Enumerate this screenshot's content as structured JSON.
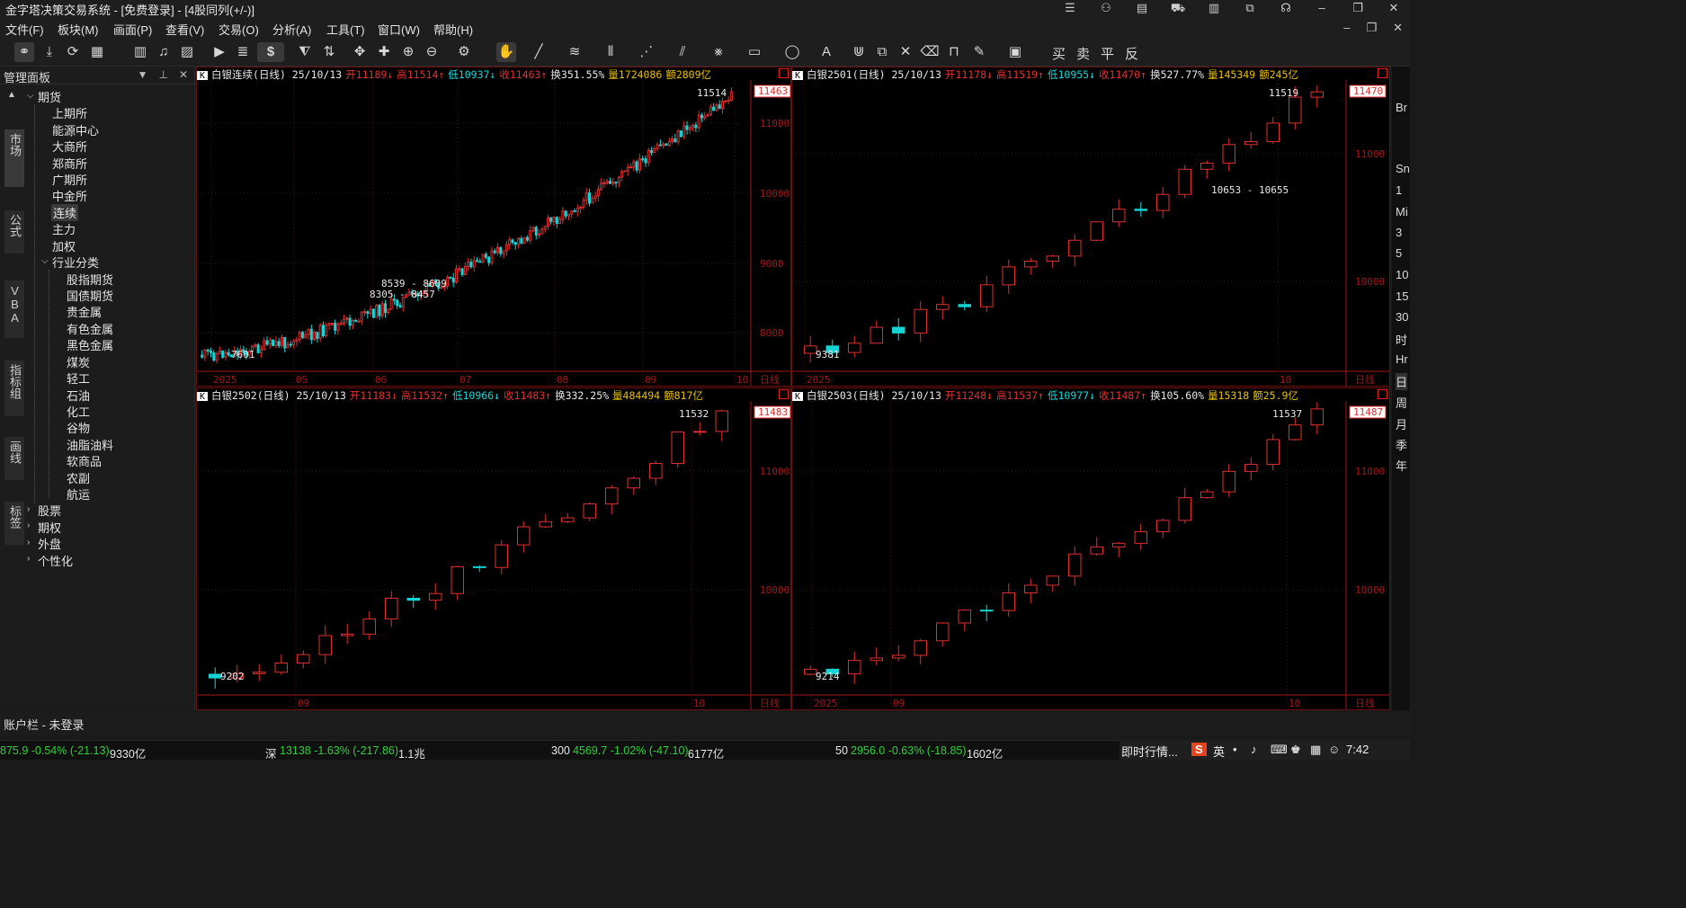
{
  "window": {
    "title": "金字塔决策交易系统 - [免费登录] - [4股同列(+/-)]"
  },
  "menu": [
    "文件(F)",
    "板块(M)",
    "画面(P)",
    "查看(V)",
    "交易(O)",
    "分析(A)",
    "工具(T)",
    "窗口(W)",
    "帮助(H)"
  ],
  "toolbar": {
    "currency_symbol": "$",
    "trade_buy": "买",
    "trade_sell": "卖",
    "trade_flat": "平",
    "trade_reverse": "反"
  },
  "side_panel": {
    "title": "管理面板",
    "vtabs": [
      "市场",
      "公式",
      "VBA",
      "指标组",
      "画线",
      "标签"
    ],
    "tree": {
      "futures": "期货",
      "exchanges": [
        "上期所",
        "能源中心",
        "大商所",
        "郑商所",
        "广期所",
        "中金所"
      ],
      "selected": "连续",
      "extra": [
        "主力",
        "加权"
      ],
      "industry": "行业分类",
      "industries": [
        "股指期货",
        "国债期货",
        "贵金属",
        "有色金属",
        "黑色金属",
        "煤炭",
        "轻工",
        "石油",
        "化工",
        "谷物",
        "油脂油料",
        "软商品",
        "农副",
        "航运"
      ],
      "roots": [
        "股票",
        "期权",
        "外盘",
        "个性化"
      ]
    }
  },
  "panels": [
    {
      "name": "白银连续(日线)",
      "date": "25/10/13",
      "open": "开11189",
      "high": "高11514",
      "low": "低10937",
      "close": "收11463",
      "change": "换351.55%",
      "volume": "量1724086",
      "amount": "额2809亿",
      "last_price": "11463",
      "y_ticks": [
        "11000",
        "10000",
        "9000",
        "8000"
      ],
      "x_labels": [
        "2025",
        "05",
        "06",
        "07",
        "08",
        "09",
        "10"
      ],
      "period_label": "日线",
      "annotations": {
        "high": "11514",
        "low": "7601",
        "range1": "8539 - 8609",
        "range2": "8305 - 8457"
      }
    },
    {
      "name": "白银2501(日线)",
      "date": "25/10/13",
      "open": "开11178",
      "high": "高11519",
      "low": "低10955",
      "close": "收11470",
      "change": "换527.77%",
      "volume": "量145349",
      "amount": "额245亿",
      "last_price": "11470",
      "y_ticks": [
        "11000",
        "10000"
      ],
      "x_labels": [
        "2025",
        "10"
      ],
      "period_label": "日线",
      "annotations": {
        "high": "11519",
        "low": "9381",
        "range1": "10653 - 10655"
      }
    },
    {
      "name": "白银2502(日线)",
      "date": "25/10/13",
      "open": "开11183",
      "high": "高11532",
      "low": "低10966",
      "close": "收11483",
      "change": "换332.25%",
      "volume": "量484494",
      "amount": "额817亿",
      "last_price": "11483",
      "y_ticks": [
        "11000",
        "10000"
      ],
      "x_labels": [
        "09",
        "10"
      ],
      "period_label": "日线",
      "annotations": {
        "high": "11532",
        "low": "9202"
      }
    },
    {
      "name": "白银2503(日线)",
      "date": "25/10/13",
      "open": "开11248",
      "high": "高11537",
      "low": "低10977",
      "close": "收11487",
      "change": "换105.60%",
      "volume": "量15318",
      "amount": "额25.9亿",
      "last_price": "11487",
      "y_ticks": [
        "11000",
        "10000"
      ],
      "x_labels": [
        "2025",
        "09",
        "10"
      ],
      "period_label": "日线",
      "annotations": {
        "high": "11537",
        "low": "9214"
      }
    }
  ],
  "right_strip": [
    "Br",
    "Sn",
    "1",
    "Mi",
    "3",
    "5",
    "10",
    "15",
    "30",
    "时",
    "Hr",
    "日",
    "周",
    "月",
    "季",
    "年"
  ],
  "account_bar": "账户栏 - 未登录",
  "status": {
    "sh": "875.9 -0.54% (-21.13)",
    "sh_amt": "9330亿",
    "sz_label": "深",
    "sz": "13138 -1.63% (-217.86)",
    "sz_amt": "1.1兆",
    "i300_label": "300",
    "i300": "4569.7 -1.02% (-47.10)",
    "i300_amt": "6177亿",
    "i50_label": "50",
    "i50": "2956.0 -0.63% (-18.85)",
    "i50_amt": "1602亿",
    "news": "即时行情...",
    "ime_lang": "英",
    "clock": "7:42"
  },
  "colors": {
    "up": "#e03030",
    "down": "#16d4d4",
    "axis": "#a01818",
    "gold": "#e8c000"
  }
}
